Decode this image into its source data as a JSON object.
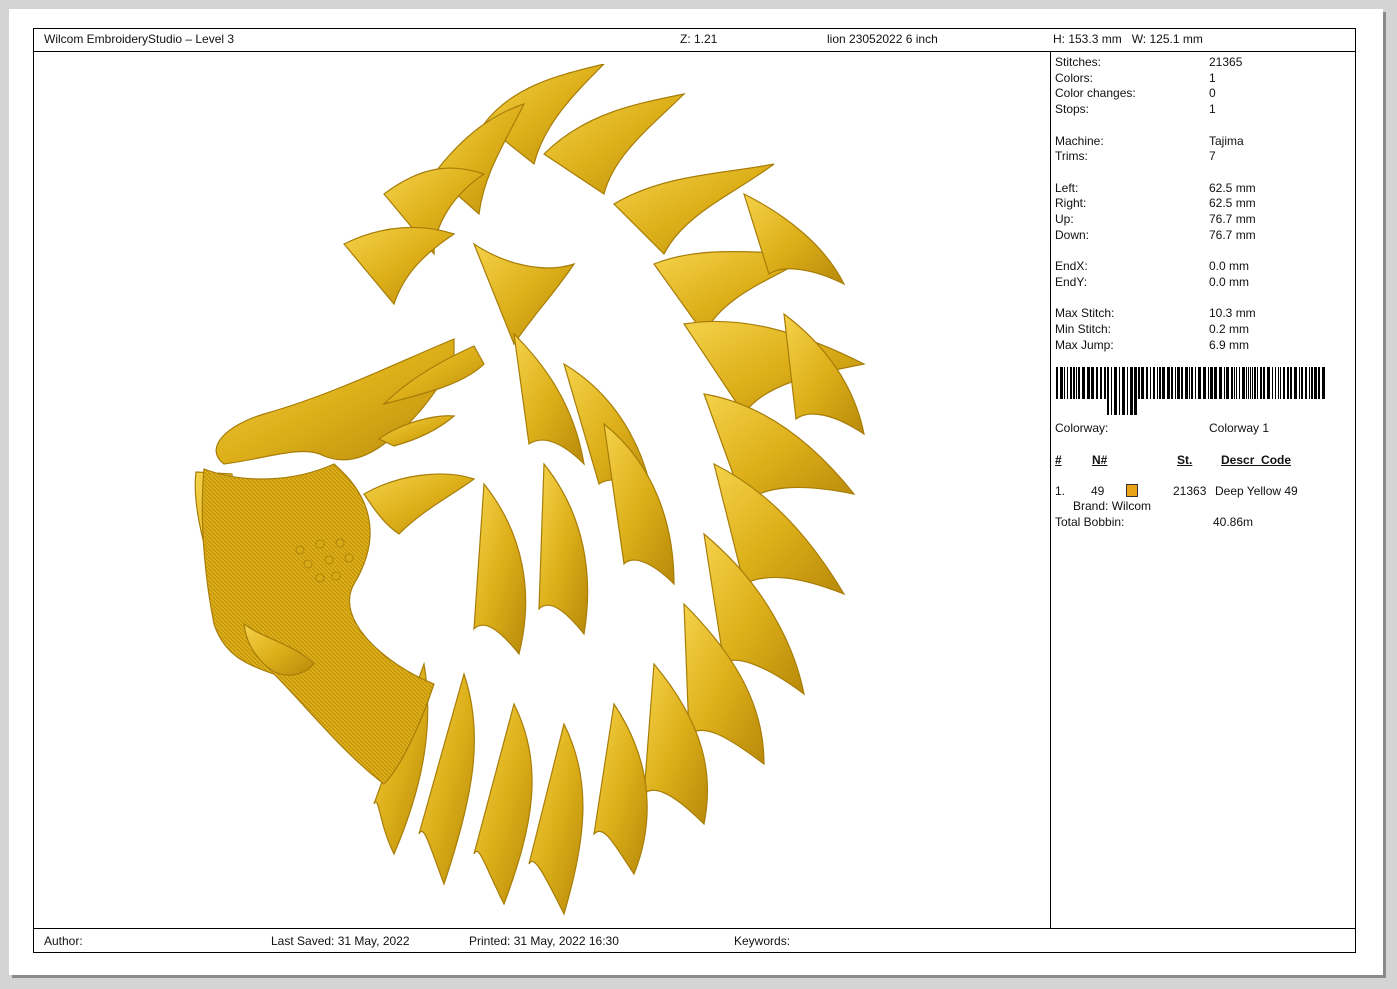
{
  "header": {
    "app_title": "Wilcom EmbroideryStudio – Level 3",
    "zoom": "Z: 1.21",
    "design_name": "lion 23052022 6 inch",
    "dimensions": "H: 153.3 mm   W: 125.1 mm"
  },
  "stats": [
    {
      "label": "Stitches:",
      "value": "21365"
    },
    {
      "label": "Colors:",
      "value": "1"
    },
    {
      "label": "Color changes:",
      "value": "0"
    },
    {
      "label": "Stops:",
      "value": "1"
    },
    {
      "label": "Machine:",
      "value": "Tajima"
    },
    {
      "label": "Trims:",
      "value": "7"
    },
    {
      "label": "Left:",
      "value": "62.5 mm"
    },
    {
      "label": "Right:",
      "value": "62.5 mm"
    },
    {
      "label": "Up:",
      "value": "76.7 mm"
    },
    {
      "label": "Down:",
      "value": "76.7 mm"
    },
    {
      "label": "EndX:",
      "value": "0.0 mm"
    },
    {
      "label": "EndY:",
      "value": "0.0 mm"
    },
    {
      "label": "Max Stitch:",
      "value": "10.3 mm"
    },
    {
      "label": "Min Stitch:",
      "value": "0.2 mm"
    },
    {
      "label": "Max Jump:",
      "value": "6.9 mm"
    }
  ],
  "colorway": {
    "label": "Colorway:",
    "value": "Colorway 1",
    "columns": {
      "num": "#",
      "needle": "N#",
      "stitches": "St.",
      "descr": "Descr_Code"
    },
    "rows": [
      {
        "num": "1.",
        "needle": "49",
        "stitches": "21363",
        "descr": "Deep Yellow 49",
        "brand": "Brand: Wilcom",
        "color": "#e8a317"
      }
    ],
    "bobbin_label": "Total Bobbin:",
    "bobbin_value": "40.86m"
  },
  "footer": {
    "author": "Author:",
    "last_saved": "Last Saved: 31 May, 2022",
    "printed": "Printed: 31 May, 2022 16:30",
    "keywords": "Keywords:"
  },
  "colors": {
    "thread_gold": "#e0b21c",
    "thread_shadow": "#a77d08",
    "thread_highlight": "#f7d54c"
  },
  "icons": {
    "design": "lion-head-embroidery",
    "barcode": "barcode-icon"
  }
}
